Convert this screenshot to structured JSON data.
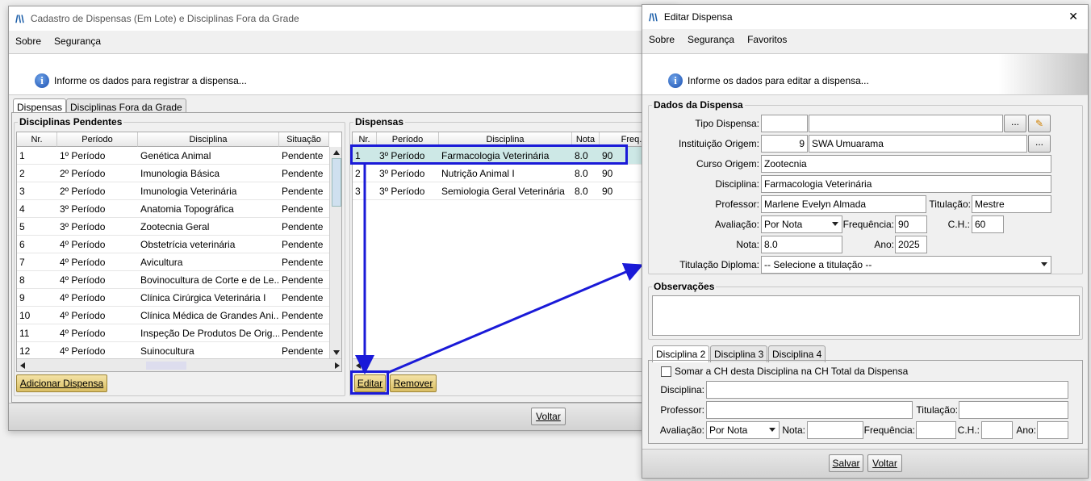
{
  "main_window": {
    "title": "Cadastro de Dispensas (Em Lote) e Disciplinas Fora da Grade",
    "menu": [
      "Sobre",
      "Segurança"
    ],
    "info_text": "Informe os dados para registrar a dispensa...",
    "tabs": [
      "Dispensas",
      "Disciplinas Fora da Grade"
    ],
    "pending_group_title": "Disciplinas Pendentes",
    "pending_columns": [
      "Nr.",
      "Período",
      "Disciplina",
      "Situação"
    ],
    "pending_rows": [
      [
        "1",
        "1º Período",
        "Genética Animal",
        "Pendente"
      ],
      [
        "2",
        "2º Período",
        " Imunologia Básica",
        "Pendente"
      ],
      [
        "3",
        "2º Período",
        "Imunologia Veterinária",
        "Pendente"
      ],
      [
        "4",
        "3º Período",
        "Anatomia Topográfica",
        "Pendente"
      ],
      [
        "5",
        "3º Período",
        "Zootecnia Geral",
        "Pendente"
      ],
      [
        "6",
        "4º Período",
        " Obstetrícia veterinária",
        "Pendente"
      ],
      [
        "7",
        "4º Período",
        "Avicultura",
        "Pendente"
      ],
      [
        "8",
        "4º Período",
        "Bovinocultura de Corte e de Le...",
        "Pendente"
      ],
      [
        "9",
        "4º Período",
        "Clínica Cirúrgica Veterinária I",
        "Pendente"
      ],
      [
        "10",
        "4º Período",
        "Clínica Médica de Grandes Ani...",
        "Pendente"
      ],
      [
        "11",
        "4º Período",
        "Inspeção De Produtos De Orig...",
        "Pendente"
      ],
      [
        "12",
        "4º Período",
        "Suinocultura",
        "Pendente"
      ]
    ],
    "add_button": "Adicionar Dispensa",
    "dispensas_group_title": "Dispensas",
    "dispensas_columns": [
      "Nr.",
      "Período",
      "Disciplina",
      "Nota",
      "Freq."
    ],
    "dispensas_rows": [
      [
        "1",
        "3º Período",
        "Farmacologia Veterinária",
        "8.0",
        "90"
      ],
      [
        "2",
        "3º Período",
        "Nutrição Animal I",
        "8.0",
        "90"
      ],
      [
        "3",
        "3º Período",
        "Semiologia Geral Veterinária",
        "8.0",
        "90"
      ]
    ],
    "edit_button": "Editar",
    "remove_button": "Remover",
    "back_button": "Voltar"
  },
  "edit_dialog": {
    "title": "Editar Dispensa",
    "close_glyph": "✕",
    "menu": [
      "Sobre",
      "Segurança",
      "Favoritos"
    ],
    "info_text": "Informe os dados para editar a dispensa...",
    "group_title": "Dados da Dispensa",
    "labels": {
      "tipo": "Tipo Dispensa:",
      "instituicao": "Instituição Origem:",
      "curso": "Curso Origem:",
      "disciplina": "Disciplina:",
      "professor": "Professor:",
      "titulacao": "Titulação:",
      "avaliacao": "Avaliação:",
      "frequencia": "Frequência:",
      "ch": "C.H.:",
      "nota": "Nota:",
      "ano": "Ano:",
      "titulacao_diploma": "Titulação Diploma:"
    },
    "values": {
      "tipo_code": "",
      "tipo_name": "",
      "instituicao_code": "9",
      "instituicao_name": "SWA Umuarama",
      "curso": "Zootecnia",
      "disciplina": "Farmacologia Veterinária",
      "professor": "Marlene Evelyn Almada",
      "titulacao": "Mestre",
      "avaliacao": "Por Nota",
      "frequencia": "90",
      "ch": "60",
      "nota": "8.0",
      "ano": "2025",
      "titulacao_diploma": "-- Selecione a titulação --"
    },
    "ellipsis": "...",
    "observacoes_title": "Observações",
    "tabs": [
      "Disciplina 2",
      "Disciplina 3",
      "Disciplina 4"
    ],
    "sub": {
      "checkbox_label": "Somar a CH desta Disciplina na CH Total da Dispensa",
      "disciplina": "Disciplina:",
      "professor": "Professor:",
      "titulacao": "Titulação:",
      "avaliacao": "Avaliação:",
      "avaliacao_value": "Por Nota",
      "nota": "Nota:",
      "frequencia": "Frequência:",
      "ch": "C.H.:",
      "ano": "Ano:"
    },
    "save_button": "Salvar",
    "back_button": "Voltar"
  },
  "colors": {
    "highlight": "#1a1ad8",
    "selected_row": "#cde8e6",
    "gold_button": "#e6cf7e"
  }
}
